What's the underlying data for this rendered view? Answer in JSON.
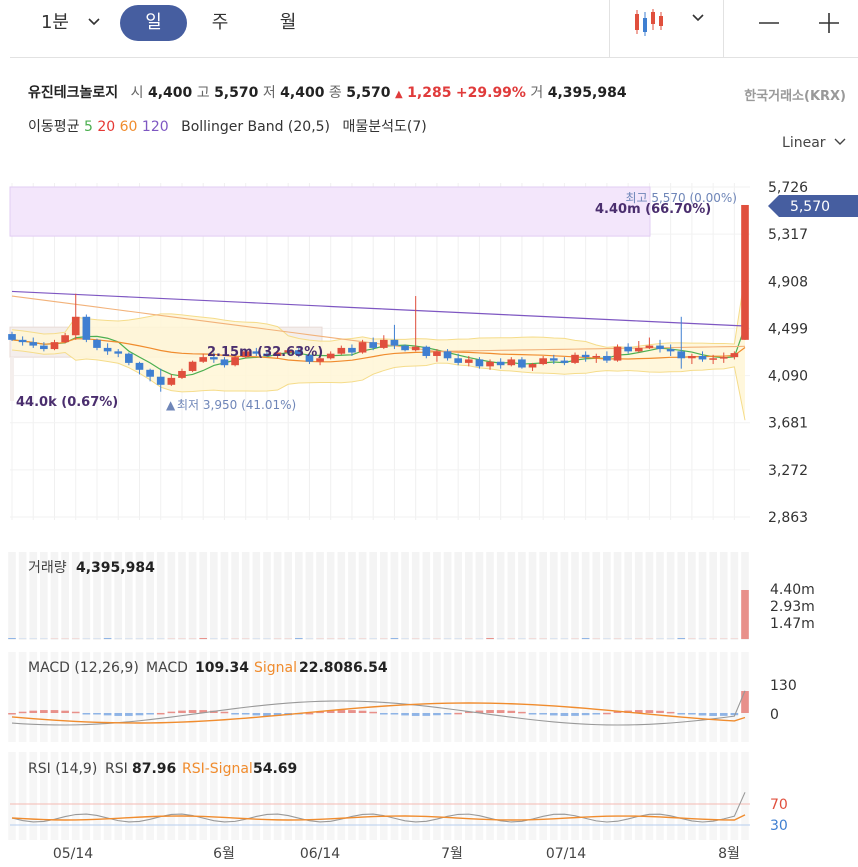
{
  "toolbar": {
    "periods": [
      "1분",
      "일",
      "주",
      "월"
    ],
    "active_period": "일",
    "minus_label": "—",
    "plus_label": "+"
  },
  "stock": {
    "name": "유진테크놀로지",
    "open_label": "시",
    "open": "4,400",
    "high_label": "고",
    "high": "5,570",
    "low_label": "저",
    "low": "4,400",
    "close_label": "종",
    "close": "5,570",
    "change": "1,285",
    "change_pct": "+29.99%",
    "volume_label": "거",
    "volume": "4,395,984",
    "exchange": "한국거래소(KRX)"
  },
  "indicators": {
    "ma_label": "이동평균",
    "ma_periods": [
      "5",
      "20",
      "60",
      "120"
    ],
    "ma_colors": [
      "#4caf50",
      "#e53935",
      "#f08c2e",
      "#7e57c2"
    ],
    "bollinger": "Bollinger Band (20,5)",
    "volume_profile": "매물분석도(7)"
  },
  "scale_mode": "Linear",
  "main_chart": {
    "price_ticks": [
      "5,726",
      "5,317",
      "4,908",
      "4,499",
      "4,090",
      "3,681",
      "3,272",
      "2,863"
    ],
    "current_price": "5,570",
    "high_annotation": "최고 5,570 (0.00%)",
    "low_annotation": "최저 3,950 (41.01%)",
    "profile_labels": [
      "4.40m (66.70%)",
      "2.15m (32.63%)",
      "44.0k (0.67%)"
    ],
    "up_color": "#e04f3d",
    "down_color": "#3f7fd1"
  },
  "volume_panel": {
    "label": "거래량",
    "value": "4,395,984",
    "ticks": [
      "4.40m",
      "2.93m",
      "1.47m"
    ]
  },
  "macd_panel": {
    "label": "MACD (12,26,9)",
    "macd_label": "MACD",
    "macd_value": "109.34",
    "signal_label": "Signal",
    "signal_value": "22.8086.54",
    "ticks": [
      "130",
      "0"
    ]
  },
  "rsi_panel": {
    "label": "RSI (14,9)",
    "rsi_label": "RSI",
    "rsi_value": "87.96",
    "signal_label": "RSI-Signal",
    "signal_value": "54.69",
    "ticks": [
      "70",
      "30"
    ]
  },
  "x_axis": {
    "labels": [
      "05/14",
      "6월",
      "06/14",
      "7월",
      "07/14",
      "8월"
    ]
  },
  "chart_data": {
    "type": "candlestick",
    "series": [
      {
        "name": "price",
        "values": [
          [
            4450,
            4470,
            4390,
            4400
          ],
          [
            4400,
            4430,
            4350,
            4380
          ],
          [
            4380,
            4420,
            4330,
            4350
          ],
          [
            4350,
            4380,
            4300,
            4320
          ],
          [
            4320,
            4400,
            4310,
            4380
          ],
          [
            4380,
            4460,
            4370,
            4440
          ],
          [
            4440,
            4800,
            4400,
            4600
          ],
          [
            4600,
            4620,
            4380,
            4400
          ],
          [
            4400,
            4410,
            4310,
            4330
          ],
          [
            4330,
            4370,
            4270,
            4300
          ],
          [
            4300,
            4320,
            4250,
            4280
          ],
          [
            4280,
            4290,
            4180,
            4200
          ],
          [
            4200,
            4210,
            4100,
            4140
          ],
          [
            4140,
            4150,
            4040,
            4080
          ],
          [
            4080,
            4150,
            3950,
            4010
          ],
          [
            4010,
            4100,
            4000,
            4070
          ],
          [
            4070,
            4150,
            4060,
            4130
          ],
          [
            4130,
            4220,
            4120,
            4210
          ],
          [
            4210,
            4280,
            4200,
            4250
          ],
          [
            4250,
            4290,
            4200,
            4230
          ],
          [
            4230,
            4250,
            4160,
            4180
          ],
          [
            4180,
            4260,
            4170,
            4250
          ],
          [
            4250,
            4320,
            4240,
            4300
          ],
          [
            4300,
            4330,
            4260,
            4280
          ],
          [
            4280,
            4310,
            4250,
            4260
          ],
          [
            4260,
            4300,
            4240,
            4290
          ],
          [
            4290,
            4330,
            4270,
            4310
          ],
          [
            4310,
            4340,
            4250,
            4270
          ],
          [
            4270,
            4280,
            4190,
            4210
          ],
          [
            4210,
            4250,
            4180,
            4240
          ],
          [
            4240,
            4300,
            4230,
            4280
          ],
          [
            4280,
            4350,
            4270,
            4330
          ],
          [
            4330,
            4360,
            4260,
            4290
          ],
          [
            4290,
            4400,
            4280,
            4380
          ],
          [
            4380,
            4420,
            4310,
            4330
          ],
          [
            4330,
            4440,
            4320,
            4400
          ],
          [
            4400,
            4530,
            4320,
            4350
          ],
          [
            4350,
            4360,
            4300,
            4310
          ],
          [
            4310,
            4780,
            4300,
            4340
          ],
          [
            4340,
            4350,
            4240,
            4260
          ],
          [
            4260,
            4320,
            4210,
            4300
          ],
          [
            4300,
            4320,
            4220,
            4240
          ],
          [
            4240,
            4280,
            4180,
            4200
          ],
          [
            4200,
            4260,
            4170,
            4230
          ],
          [
            4230,
            4250,
            4150,
            4170
          ],
          [
            4170,
            4230,
            4140,
            4210
          ],
          [
            4210,
            4240,
            4150,
            4180
          ],
          [
            4180,
            4250,
            4170,
            4230
          ],
          [
            4230,
            4250,
            4150,
            4160
          ],
          [
            4160,
            4200,
            4130,
            4190
          ],
          [
            4190,
            4260,
            4180,
            4240
          ],
          [
            4240,
            4270,
            4190,
            4220
          ],
          [
            4220,
            4250,
            4180,
            4200
          ],
          [
            4200,
            4290,
            4190,
            4270
          ],
          [
            4270,
            4300,
            4210,
            4250
          ],
          [
            4250,
            4280,
            4200,
            4260
          ],
          [
            4260,
            4300,
            4200,
            4220
          ],
          [
            4220,
            4360,
            4210,
            4340
          ],
          [
            4340,
            4370,
            4280,
            4300
          ],
          [
            4300,
            4390,
            4290,
            4330
          ],
          [
            4330,
            4420,
            4320,
            4350
          ],
          [
            4350,
            4400,
            4290,
            4320
          ],
          [
            4320,
            4360,
            4260,
            4300
          ],
          [
            4300,
            4600,
            4150,
            4240
          ],
          [
            4240,
            4280,
            4190,
            4260
          ],
          [
            4260,
            4300,
            4210,
            4230
          ],
          [
            4230,
            4270,
            4190,
            4240
          ],
          [
            4240,
            4290,
            4200,
            4250
          ],
          [
            4250,
            4300,
            4230,
            4285
          ],
          [
            4400,
            5570,
            4400,
            5570
          ]
        ]
      }
    ],
    "ylim": [
      2863,
      5726
    ],
    "xlabels": [
      "05/14",
      "6월",
      "06/14",
      "7월",
      "07/14",
      "8월"
    ]
  }
}
